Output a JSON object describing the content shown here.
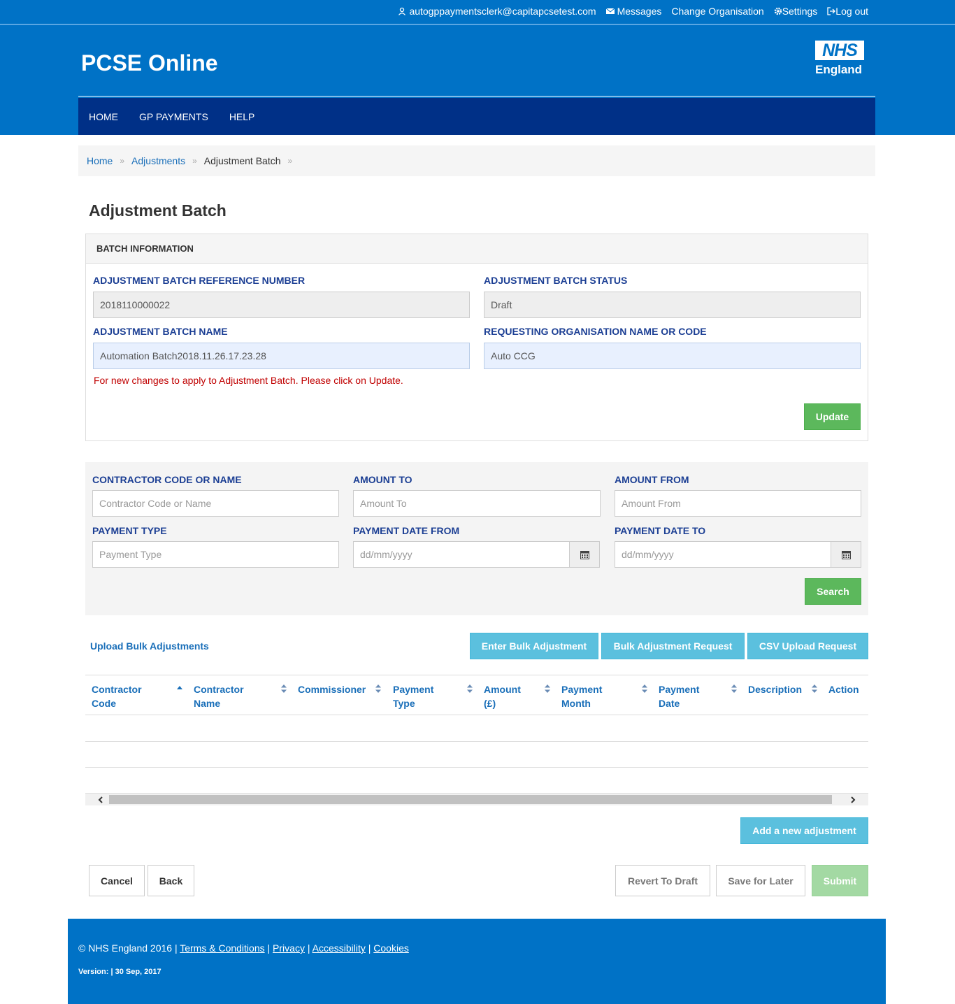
{
  "header": {
    "user_email": "autogppaymentsclerk@capitapcsetest.com",
    "messages": "Messages",
    "change_org": "Change Organisation",
    "settings": "Settings",
    "logout": "Log out",
    "brand": "PCSE Online",
    "logo_nhs": "NHS",
    "logo_england": "England"
  },
  "nav": {
    "home": "HOME",
    "gp_payments": "GP PAYMENTS",
    "help": "HELP"
  },
  "breadcrumb": {
    "home": "Home",
    "adjustments": "Adjustments",
    "current": "Adjustment Batch",
    "separator": "»"
  },
  "page_title": "Adjustment Batch",
  "batch": {
    "panel_title": "BATCH INFORMATION",
    "ref_label": "ADJUSTMENT BATCH REFERENCE NUMBER",
    "ref_value": "2018110000022",
    "status_label": "ADJUSTMENT BATCH STATUS",
    "status_value": "Draft",
    "name_label": "ADJUSTMENT BATCH NAME",
    "name_value": "Automation Batch2018.11.26.17.23.28",
    "org_label": "REQUESTING ORGANISATION NAME OR CODE",
    "org_value": "Auto CCG",
    "warning": "For new changes to apply to Adjustment Batch. Please click on Update.",
    "update_button": "Update"
  },
  "search": {
    "contractor_label": "CONTRACTOR CODE OR NAME",
    "contractor_placeholder": "Contractor Code or Name",
    "amount_to_label": "AMOUNT TO",
    "amount_to_placeholder": "Amount To",
    "amount_from_label": "AMOUNT FROM",
    "amount_from_placeholder": "Amount From",
    "payment_type_label": "PAYMENT TYPE",
    "payment_type_placeholder": "Payment Type",
    "date_from_label": "PAYMENT DATE FROM",
    "date_from_placeholder": "dd/mm/yyyy",
    "date_to_label": "PAYMENT DATE TO",
    "date_to_placeholder": "dd/mm/yyyy",
    "search_button": "Search"
  },
  "actions": {
    "upload_bulk": "Upload Bulk Adjustments",
    "enter_bulk": "Enter Bulk Adjustment",
    "bulk_request": "Bulk Adjustment Request",
    "csv_request": "CSV Upload Request",
    "add_new": "Add a new adjustment"
  },
  "table": {
    "columns": [
      {
        "line1": "Contractor",
        "line2": "Code"
      },
      {
        "line1": "Contractor",
        "line2": "Name"
      },
      {
        "line1": "Commissioner",
        "line2": ""
      },
      {
        "line1": "Payment",
        "line2": "Type"
      },
      {
        "line1": "Amount",
        "line2": "(£)"
      },
      {
        "line1": "Payment",
        "line2": "Month"
      },
      {
        "line1": "Payment",
        "line2": "Date"
      },
      {
        "line1": "Description",
        "line2": ""
      },
      {
        "line1": "Action",
        "line2": ""
      }
    ],
    "rows": []
  },
  "bottom_buttons": {
    "cancel": "Cancel",
    "back": "Back",
    "revert": "Revert To Draft",
    "save_later": "Save for Later",
    "submit": "Submit"
  },
  "footer": {
    "copyright": "© NHS England 2016 |",
    "terms": "Terms & Conditions",
    "privacy": "Privacy",
    "accessibility": "Accessibility",
    "cookies": "Cookies",
    "divider": "|",
    "version": "Version: | 30 Sep, 2017"
  },
  "colors": {
    "header_blue": "#0072c6",
    "nav_dark_blue": "#003087",
    "label_blue": "#1c3f94",
    "green": "#5cb85c",
    "cyan": "#5bc0de",
    "warning_red": "#c00000"
  },
  "icons": {
    "user": "user-icon",
    "messages": "envelope-icon",
    "settings": "gear-icon",
    "logout": "logout-icon",
    "calendar": "calendar-icon",
    "sort": "sort-icon"
  }
}
